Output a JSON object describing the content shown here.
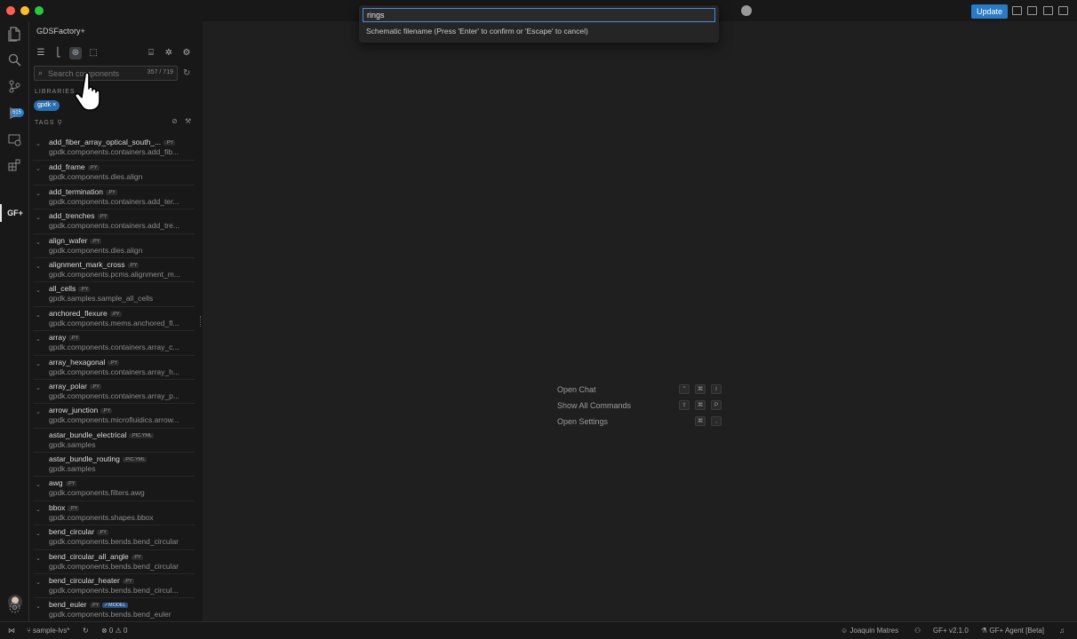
{
  "titlebar": {
    "update_label": "Update"
  },
  "activity": {
    "scm_badge": "515",
    "extension_label": "GF+",
    "manage_badge": "1"
  },
  "sidebar": {
    "title": "GDSFactory+",
    "search": {
      "placeholder": "Search components",
      "count": "357 / 719"
    },
    "libraries_label": "LIBRARIES",
    "library_chip": "gpdk ×",
    "tags_label": "TAGS"
  },
  "components": [
    {
      "name": "add_fiber_array_optical_south_...",
      "tag": ".PY",
      "path": "gpdk.components.containers.add_fib..."
    },
    {
      "name": "add_frame",
      "tag": ".PY",
      "path": "gpdk.components.dies.align"
    },
    {
      "name": "add_termination",
      "tag": ".PY",
      "path": "gpdk.components.containers.add_ter..."
    },
    {
      "name": "add_trenches",
      "tag": ".PY",
      "path": "gpdk.components.containers.add_tre..."
    },
    {
      "name": "align_wafer",
      "tag": ".PY",
      "path": "gpdk.components.dies.align"
    },
    {
      "name": "alignment_mark_cross",
      "tag": ".PY",
      "path": "gpdk.components.pcms.alignment_m..."
    },
    {
      "name": "all_cells",
      "tag": ".PY",
      "path": "gpdk.samples.sample_all_cells"
    },
    {
      "name": "anchored_flexure",
      "tag": ".PY",
      "path": "gpdk.components.mems.anchored_fl..."
    },
    {
      "name": "array",
      "tag": ".PY",
      "path": "gpdk.components.containers.array_c..."
    },
    {
      "name": "array_hexagonal",
      "tag": ".PY",
      "path": "gpdk.components.containers.array_h..."
    },
    {
      "name": "array_polar",
      "tag": ".PY",
      "path": "gpdk.components.containers.array_p..."
    },
    {
      "name": "arrow_junction",
      "tag": ".PY",
      "path": "gpdk.components.microfluidics.arrow..."
    },
    {
      "name": "astar_bundle_electrical",
      "tag": ".PIC.YML",
      "path": "gpdk.samples"
    },
    {
      "name": "astar_bundle_routing",
      "tag": ".PIC.YML",
      "path": "gpdk.samples"
    },
    {
      "name": "awg",
      "tag": ".PY",
      "path": "gpdk.components.filters.awg"
    },
    {
      "name": "bbox",
      "tag": ".PY",
      "path": "gpdk.components.shapes.bbox"
    },
    {
      "name": "bend_circular",
      "tag": ".PY",
      "path": "gpdk.components.bends.bend_circular"
    },
    {
      "name": "bend_circular_all_angle",
      "tag": ".PY",
      "path": "gpdk.components.bends.bend_circular"
    },
    {
      "name": "bend_circular_heater",
      "tag": ".PY",
      "path": "gpdk.components.bends.bend_circul..."
    },
    {
      "name": "bend_euler",
      "tag": ".PY",
      "model": "✓MODEL",
      "path": "gpdk.components.bends.bend_euler"
    }
  ],
  "quickinput": {
    "value": "rings",
    "message": "Schematic filename (Press 'Enter' to confirm or 'Escape' to cancel)"
  },
  "watermark": [
    {
      "label": "Open Chat",
      "keys": [
        "⌃",
        "⌘",
        "I"
      ]
    },
    {
      "label": "Show All Commands",
      "keys": [
        "⇧",
        "⌘",
        "P"
      ]
    },
    {
      "label": "Open Settings",
      "keys": [
        "⌘",
        ","
      ]
    }
  ],
  "statusbar": {
    "branch": "sample-lvs*",
    "problems": "⊗ 0 ⚠ 0",
    "account": "Joaquin Matres",
    "version": "GF+ v2.1.0",
    "agent": "GF+ Agent [Beta]"
  },
  "colors": {
    "accent": "#2a7bc6",
    "background": "#181818",
    "editor_background": "#1f1f1f"
  }
}
